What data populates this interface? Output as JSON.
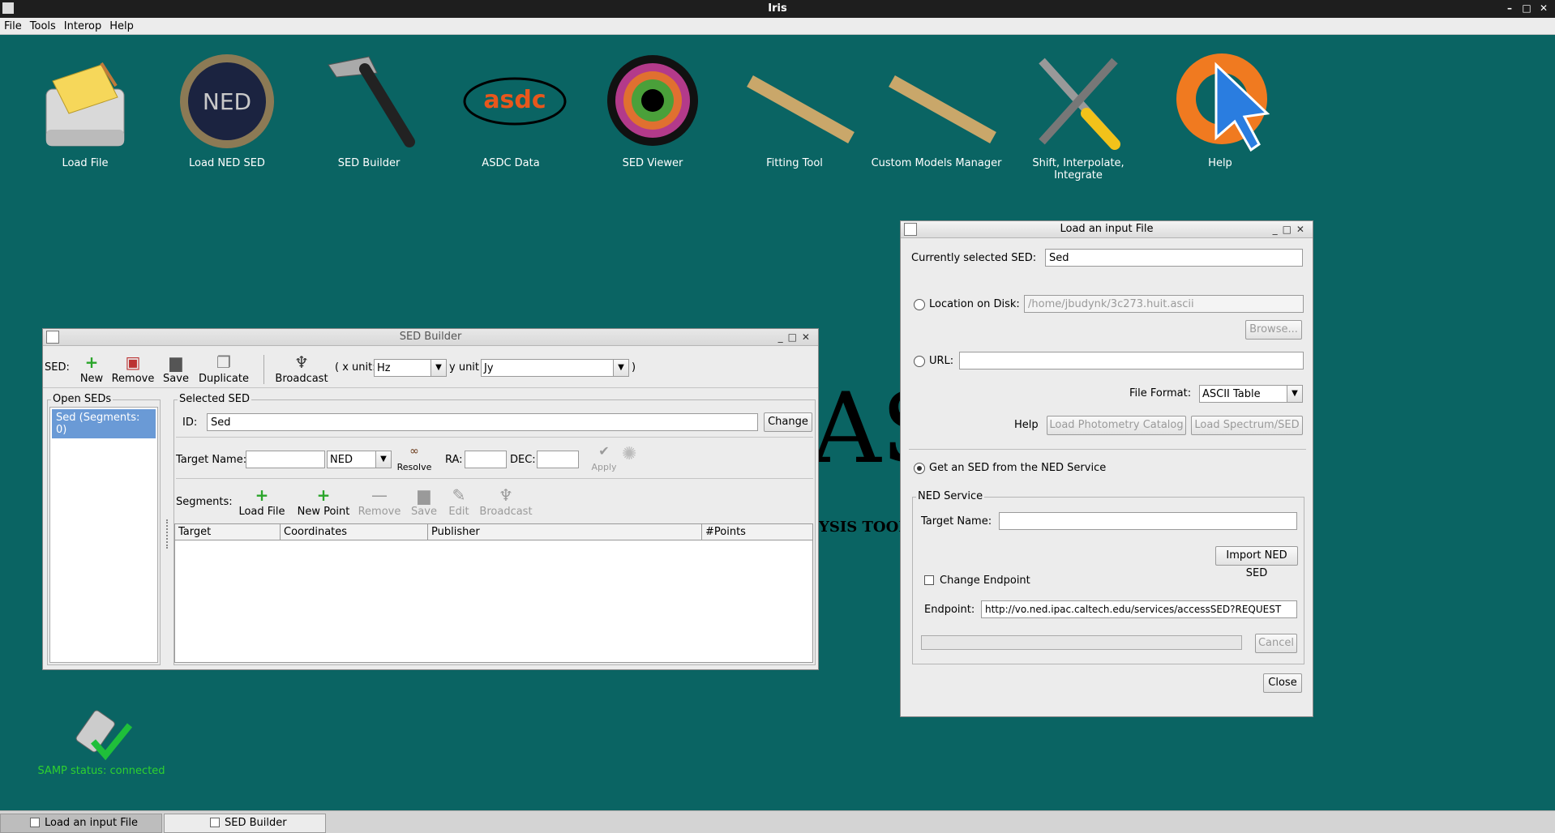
{
  "app": {
    "title": "Iris"
  },
  "menu": [
    "File",
    "Tools",
    "Interop",
    "Help"
  ],
  "desktop_icons": [
    {
      "label": "Load File",
      "icon": "folder-drive-icon"
    },
    {
      "label": "Load NED SED",
      "icon": "ned-logo-icon"
    },
    {
      "label": "SED Builder",
      "icon": "hammer-icon"
    },
    {
      "label": "ASDC Data",
      "icon": "asdc-logo-icon"
    },
    {
      "label": "SED Viewer",
      "icon": "color-eye-icon"
    },
    {
      "label": "Fitting Tool",
      "icon": "ruler-icon"
    },
    {
      "label": "Custom Models Manager",
      "icon": "ruler-icon"
    },
    {
      "label": "Shift, Interpolate, Integrate",
      "icon": "tools-icon"
    },
    {
      "label": "Help",
      "icon": "lifebuoy-cursor-icon"
    }
  ],
  "background_logo": {
    "letters": "AS",
    "subtitle": "YSIS TOOL"
  },
  "samp": {
    "status": "SAMP status: connected",
    "color": "#2fd12f"
  },
  "sed_builder": {
    "title": "SED Builder",
    "sed_label": "SED:",
    "toolbar": {
      "new": "New",
      "remove": "Remove",
      "save": "Save",
      "duplicate": "Duplicate",
      "broadcast": "Broadcast"
    },
    "x_unit_label": "( x unit:",
    "x_unit": "Hz",
    "y_unit_label": "y unit",
    "y_unit": "Jy",
    "close_paren": ")",
    "open_seds_title": "Open SEDs",
    "open_seds": [
      "Sed (Segments: 0)"
    ],
    "selected_sed_title": "Selected SED",
    "id_label": "ID:",
    "id_value": "Sed",
    "change": "Change",
    "target_name_label": "Target Name:",
    "target_name": "",
    "resolver": "NED",
    "resolve": "Resolve",
    "ra_label": "RA:",
    "dec_label": "DEC:",
    "apply": "Apply",
    "segments_label": "Segments:",
    "seg_toolbar": {
      "load_file": "Load File",
      "new_point": "New Point",
      "remove": "Remove",
      "save": "Save",
      "edit": "Edit",
      "broadcast": "Broadcast"
    },
    "columns": [
      "Target",
      "Coordinates",
      "Publisher",
      "#Points"
    ]
  },
  "load_file": {
    "title": "Load an input File",
    "currently_selected_label": "Currently selected SED:",
    "currently_selected": "Sed",
    "location_label": "Location on Disk:",
    "location_value": "/home/jbudynk/3c273.huit.ascii",
    "browse": "Browse...",
    "url_label": "URL:",
    "url_value": "",
    "file_format_label": "File Format:",
    "file_format": "ASCII Table",
    "help": "Help",
    "load_photometry": "Load Photometry Catalog",
    "load_spectrum": "Load Spectrum/SED",
    "ned_radio": "Get an SED from the NED Service",
    "ned_service_title": "NED Service",
    "target_name_label": "Target Name:",
    "target_name": "",
    "import_ned": "Import NED SED",
    "change_endpoint": "Change Endpoint",
    "endpoint_label": "Endpoint:",
    "endpoint": "http://vo.ned.ipac.caltech.edu/services/accessSED?REQUEST",
    "cancel": "Cancel",
    "close": "Close"
  },
  "taskbar": [
    "Load an input File",
    "SED Builder"
  ]
}
